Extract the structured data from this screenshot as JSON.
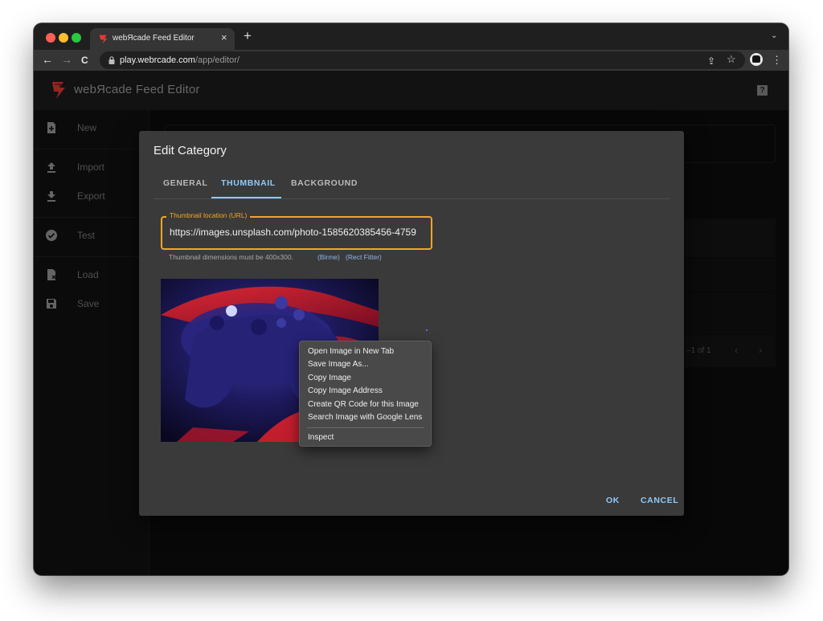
{
  "browser": {
    "tab_title": "webЯcade Feed Editor",
    "tab_close": "×",
    "new_tab": "+",
    "tabs_menu": "⌄",
    "url_domain": "play.webrcade.com",
    "url_path": "/app/editor/",
    "nav": {
      "back": "←",
      "forward": "→",
      "reload": "C"
    },
    "toolbar_icons": {
      "share": "⇪",
      "bookmark": "☆",
      "menu": "⋮"
    },
    "traffic_light_colors": [
      "#ff5f57",
      "#febc2e",
      "#28c840"
    ]
  },
  "app": {
    "title": "webЯcade Feed Editor",
    "help_glyph": "?",
    "accent_color": "#e53935",
    "sidebar": [
      {
        "label": "New",
        "icon": "new-file-icon"
      },
      {
        "label": "Import",
        "icon": "upload-icon"
      },
      {
        "label": "Export",
        "icon": "download-icon"
      },
      {
        "label": "Test",
        "icon": "check-circle-icon"
      },
      {
        "label": "Load",
        "icon": "load-file-icon"
      },
      {
        "label": "Save",
        "icon": "save-icon"
      }
    ],
    "pager_text": "–1 of 1",
    "pager_prev": "‹",
    "pager_next": "›"
  },
  "dialog": {
    "title": "Edit Category",
    "tabs": [
      {
        "label": "GENERAL",
        "active": false
      },
      {
        "label": "THUMBNAIL",
        "active": true
      },
      {
        "label": "BACKGROUND",
        "active": false
      }
    ],
    "field_label": "Thumbnail location (URL)",
    "field_value": "https://images.unsplash.com/photo-1585620385456-4759",
    "helper_text": "Thumbnail dimensions must be 400x300.",
    "helper_link_1": "(Birme)",
    "helper_link_2": "(Rect Fitter)",
    "ok_label": "OK",
    "cancel_label": "CANCEL",
    "tab_accent_color": "#90caf9",
    "field_accent_color": "#f5a623"
  },
  "context_menu": {
    "items": [
      "Open Image in New Tab",
      "Save Image As...",
      "Copy Image",
      "Copy Image Address",
      "Create QR Code for this Image",
      "Search Image with Google Lens"
    ],
    "inspect": "Inspect"
  }
}
